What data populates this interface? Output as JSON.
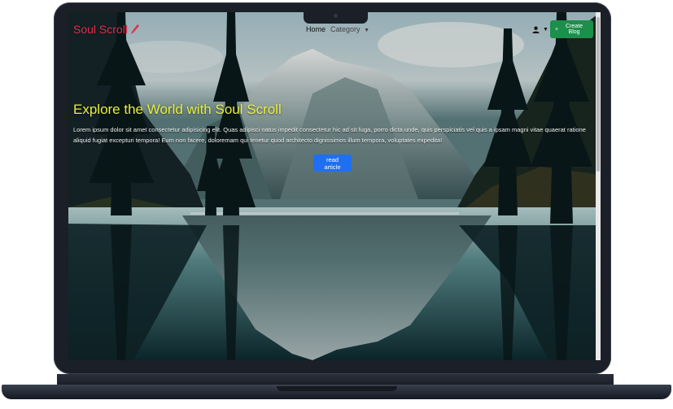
{
  "navbar": {
    "brand": "Soul Scroll",
    "links": [
      {
        "label": "Home"
      },
      {
        "label": "Category"
      }
    ],
    "create_button": "Create Blog"
  },
  "hero": {
    "title": "Explore the World with Soul Scroll",
    "text": "Lorem ipsum dolor sit amet consectetur adipisicing elit. Quas adipisci natus impedit consectetur hic ad sit fuga, porro dicta unde, quis perspiciatis vel quis a ipsam magni vitae quaerat ratione aliquid fugiat excepturi tempora! Eum non facere, doloremam qui tenetur quod architecto dignissimos illum tempora, voluptates expedita!",
    "button": "read article"
  },
  "colors": {
    "brand": "#e0314f",
    "title": "#e7ef3b",
    "create_button": "#1c8f4b",
    "read_button": "#1f6ff0"
  },
  "icons": [
    "pen-icon",
    "user-icon",
    "caret-down-icon",
    "plus-icon"
  ]
}
